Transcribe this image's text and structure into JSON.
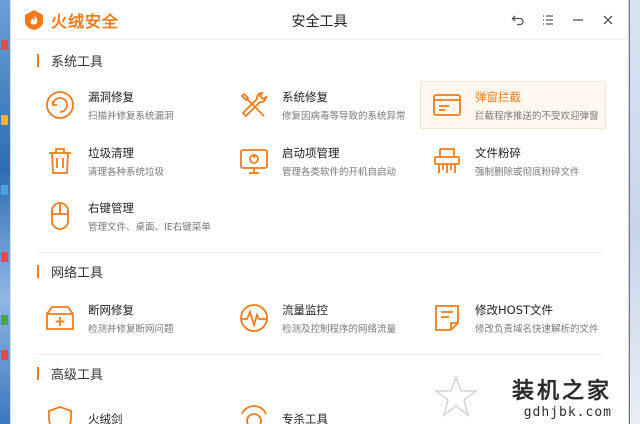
{
  "app": {
    "brand_name": "火绒安全",
    "window_title": "安全工具"
  },
  "colors": {
    "accent": "#f07b1a",
    "text": "#222222",
    "desc": "#777777"
  },
  "window_controls": [
    {
      "name": "back-icon",
      "glyph": "↶"
    },
    {
      "name": "menu-icon",
      "glyph": "☰"
    },
    {
      "name": "minimize-icon",
      "glyph": "—"
    },
    {
      "name": "close-icon",
      "glyph": "✕"
    }
  ],
  "sections": [
    {
      "title": "系统工具",
      "tools": [
        {
          "name": "漏洞修复",
          "desc": "扫描并修复系统漏洞",
          "icon": "vuln-repair-icon",
          "active": false
        },
        {
          "name": "系统修复",
          "desc": "修复因病毒等导致的系统异常",
          "icon": "wrench-screwdriver-icon",
          "active": false
        },
        {
          "name": "弹窗拦截",
          "desc": "拦截程序推送的不受欢迎弹窗",
          "icon": "popup-window-icon",
          "active": true
        },
        {
          "name": "垃圾清理",
          "desc": "清理各种系统垃圾",
          "icon": "trash-icon",
          "active": false
        },
        {
          "name": "启动项管理",
          "desc": "管理各类软件的开机自启动",
          "icon": "startup-monitor-icon",
          "active": false
        },
        {
          "name": "文件粉碎",
          "desc": "强制删除或彻底粉碎文件",
          "icon": "shredder-icon",
          "active": false
        },
        {
          "name": "右键管理",
          "desc": "管理文件、桌面、IE右键菜单",
          "icon": "mouse-icon",
          "active": false
        }
      ]
    },
    {
      "title": "网络工具",
      "tools": [
        {
          "name": "断网修复",
          "desc": "检测并修复断网问题",
          "icon": "network-repair-icon",
          "active": false
        },
        {
          "name": "流量监控",
          "desc": "检测及控制程序的网络流量",
          "icon": "traffic-monitor-icon",
          "active": false
        },
        {
          "name": "修改HOST文件",
          "desc": "修改负责域名快速解析的文件",
          "icon": "host-file-icon",
          "active": false
        }
      ]
    },
    {
      "title": "高级工具",
      "tools": [
        {
          "name": "火绒剑",
          "desc": "",
          "icon": "shield-icon",
          "active": false
        },
        {
          "name": "专杀工具",
          "desc": "",
          "icon": "scan-icon",
          "active": false
        }
      ]
    }
  ],
  "watermark": {
    "main": "装机之家",
    "sub": "gdhjbk.com"
  }
}
